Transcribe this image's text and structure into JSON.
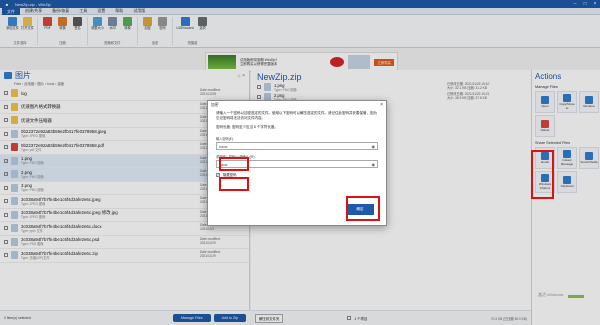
{
  "titlebar": {
    "title": "NewZip.zip - WinZip"
  },
  "ribbon_tabs": [
    "文件",
    "创建/共享",
    "备份/恢复",
    "工具",
    "设置",
    "帮助",
    "试用版"
  ],
  "ribbon_groups": [
    {
      "name": "文件选择",
      "buttons": [
        "添加文件",
        "打开文件"
      ]
    },
    {
      "name": "压缩",
      "buttons": [
        "PDF",
        "转换",
        "签名"
      ]
    },
    {
      "name": "图像和文件",
      "buttons": [
        "调整大小",
        "水印",
        "转换"
      ]
    },
    {
      "name": "加密",
      "buttons": [
        "加密",
        "密码"
      ]
    },
    {
      "name": "快捷键",
      "buttons": [
        "UUEncoded",
        "选项"
      ]
    }
  ],
  "banner": {
    "text1": "试用版即将到期 WinZip?",
    "text2": "立即购买以获得完整版本",
    "cta": "立即购买"
  },
  "left_pane": {
    "title": "图片",
    "breadcrumb": "Files › 此电脑 › 图片 › tools › 桌面",
    "files": [
      {
        "name": "log",
        "sub": "",
        "date": "2021/12/28",
        "size": "",
        "sel": false,
        "icon": "folder"
      },
      {
        "name": "优速图片格式转换器",
        "sub": "",
        "date": "2021/12/8",
        "size": "",
        "sel": false,
        "icon": "folder"
      },
      {
        "name": "优速文件压缩器",
        "sub": "",
        "date": "2021/12/8",
        "size": "",
        "sel": false,
        "icon": "folder"
      },
      {
        "name": "0b22372e92a83b59e2f0417fe0378958.jpeg",
        "sub": "Type: JPEG 图像",
        "date": "2021/11/29",
        "size": "",
        "sel": false,
        "icon": "img"
      },
      {
        "name": "0b22372e92a83b59e2f0417fe0378958.pdf",
        "sub": "Type: pdf 文件",
        "date": "2021/11/29",
        "size": "",
        "sel": false,
        "icon": "pdf"
      },
      {
        "name": "1.png",
        "sub": "Type: PNG 图像",
        "date": "2021/11/29",
        "size": "",
        "sel": true,
        "icon": "img"
      },
      {
        "name": "2.png",
        "sub": "Type: PNG 图像",
        "date": "2021/11/29",
        "size": "",
        "sel": true,
        "icon": "img"
      },
      {
        "name": "3.png",
        "sub": "Type: PNG 图像",
        "date": "2021/11/29",
        "size": "",
        "sel": false,
        "icon": "img"
      },
      {
        "name": "3c038a94f7b7fe4be1c6f4d3afe2e6c.jpeg",
        "sub": "Type: JPEG 图像",
        "date": "2021/11/29",
        "size": "",
        "sel": false,
        "icon": "img"
      },
      {
        "name": "3c038a94f7b7fe4be1c6f4d3afe2e6c.jpeg 修改.jpg",
        "sub": "Type: JPEG 图像",
        "date": "2021/11/29",
        "size": "",
        "sel": false,
        "icon": "img"
      },
      {
        "name": "3c038a94f7b7fe4be1c6f4d3afe2e6c.docx",
        "sub": "Type: pptx 文件",
        "date": "2021/12/1",
        "size": "",
        "sel": false,
        "icon": "img"
      },
      {
        "name": "3c038a94f7b7fe4be1c6f4d3afe2e6c.psd",
        "sub": "Type: PSD 图像",
        "date": "2021/11/29",
        "size": "",
        "sel": false,
        "icon": "img"
      },
      {
        "name": "3c038a94f7b7fe4be1c6f4d3afe2e6c.zip",
        "sub": "Type: 压缩(ZIP)文件",
        "date": "2021/11/29",
        "size": "",
        "sel": false,
        "icon": "img"
      }
    ],
    "date_label": "Date modified:",
    "footer": {
      "selected": "2 item(s) selected",
      "manage": "Manage Files",
      "add": "Add to Zip"
    }
  },
  "mid_pane": {
    "title": "NewZip.zip",
    "rows": [
      {
        "name": "1.png",
        "sub": "Type: PNG 图像",
        "meta1": "已修改日期: 2021/11/29 15:10",
        "meta2": "大小: 32.1 KB  压缩: 31.2 KB"
      },
      {
        "name": "2.png",
        "sub": "Type: PNG 图像",
        "meta1": "已修改日期: 2021/11/29 15:21",
        "meta2": "大小: 38.9 KB  压缩: 37.8 KB"
      }
    ],
    "footer": {
      "unzip": "解压到文件夹",
      "checkbox": "1 个项目",
      "note": "70.3 KB  (已压缩 69.0 KB)"
    }
  },
  "actions": {
    "title": "Actions",
    "manage_title": "Manage Files",
    "manage": [
      "Open",
      "Copy/Move to",
      "Rename",
      "Delete"
    ],
    "share_title": "Share Selected Files",
    "share": [
      "Email",
      "Instant Message",
      "Social Media",
      "Windows Charms",
      "Clipboard"
    ]
  },
  "watermark": "激活 Windows",
  "dialog": {
    "title": "加密",
    "message": "请输入一个密码以加密选定的文件。使用以下密码可以解压选定的文件。请记住此密码并妥善保管，因为忘记密码将无法访问文件内容。",
    "message2": "密码长度: 密码至少应当 8 个字符长度。",
    "label1": "输入密码(E):",
    "value1": "••••••",
    "label2": "重新输入密码(以便确认)(R):",
    "value2": "••••••",
    "hide": "隐藏密码",
    "ok": "确定"
  }
}
